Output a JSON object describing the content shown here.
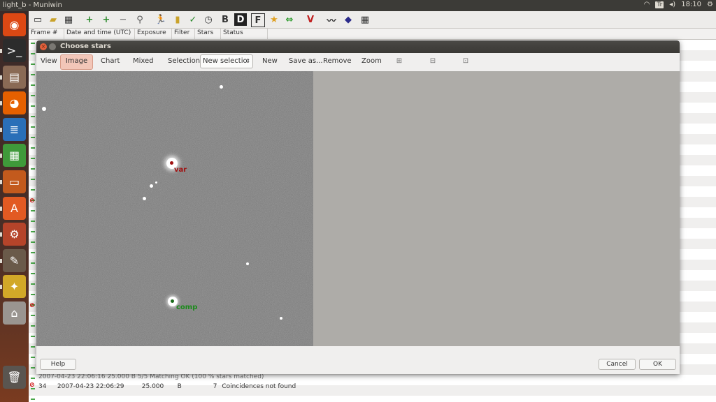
{
  "topbar": {
    "title": "light_b - Muniwin",
    "keyboard": "Tr",
    "clock": "18:10"
  },
  "launcher": {
    "items": [
      {
        "icon": "ubuntu-logo-icon",
        "color": "#dd4814",
        "glyph": "◉"
      },
      {
        "icon": "terminal-icon",
        "color": "#2c2c2c",
        "glyph": ">_"
      },
      {
        "icon": "file-manager-icon",
        "color": "#8a6a55",
        "glyph": "▤"
      },
      {
        "icon": "firefox-icon",
        "color": "#e66000",
        "glyph": "◕"
      },
      {
        "icon": "writer-icon",
        "color": "#2a6fb8",
        "glyph": "≣"
      },
      {
        "icon": "calc-icon",
        "color": "#3f9a3a",
        "glyph": "▦"
      },
      {
        "icon": "impress-icon",
        "color": "#c35a1d",
        "glyph": "▭"
      },
      {
        "icon": "software-center-icon",
        "color": "#e25a22",
        "glyph": "A"
      },
      {
        "icon": "settings-icon",
        "color": "#b5442a",
        "glyph": "⚙"
      },
      {
        "icon": "paint-icon",
        "color": "#6a5a4a",
        "glyph": "✎"
      },
      {
        "icon": "muniwin-icon",
        "color": "#d2a828",
        "glyph": "✦"
      },
      {
        "icon": "drive-icon",
        "color": "#9a9590",
        "glyph": "⌂"
      },
      {
        "icon": "trash-icon",
        "color": "#5a5550",
        "glyph": "🗑"
      }
    ]
  },
  "main": {
    "columns": [
      "Frame #",
      "Date and time (UTC)",
      "Exposure",
      "Filter",
      "Stars",
      "Status"
    ],
    "visible_rows": [
      {
        "partial": "2007-04-23 22:06:16  25.000  B   5/5  Matching OK (100 % stars matched)"
      },
      {
        "frame": "34",
        "datetime": "2007-04-23 22:06:29",
        "exposure": "25.000",
        "filter": "B",
        "stars": "7",
        "status": "Coincidences not found"
      }
    ]
  },
  "dialog": {
    "title": "Choose stars",
    "toolbar": {
      "view": "View",
      "image": "Image",
      "chart": "Chart",
      "mixed": "Mixed",
      "selection": "Selection",
      "selection_value": "New selectio",
      "new": "New",
      "save_as": "Save as...",
      "remove": "Remove",
      "zoom": "Zoom"
    },
    "stars": {
      "var_label": "var",
      "comp_label": "comp"
    },
    "buttons": {
      "help": "Help",
      "cancel": "Cancel",
      "ok": "OK"
    },
    "colors": {
      "var": "#a01010",
      "comp": "#1a8a1a",
      "image_active": "#f2c6b8"
    }
  }
}
